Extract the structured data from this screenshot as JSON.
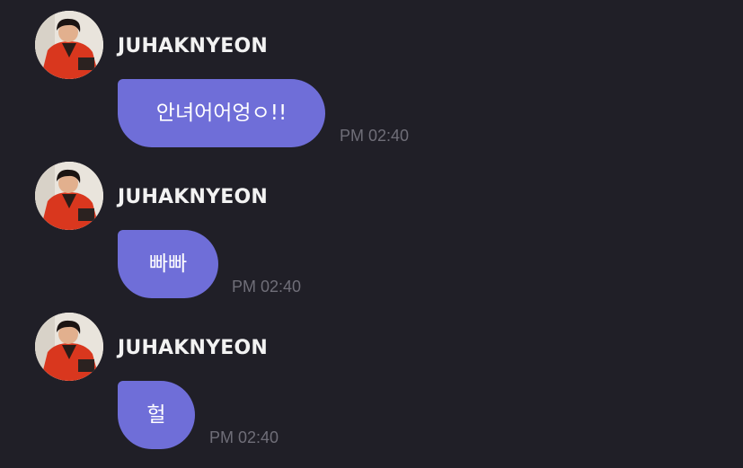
{
  "messages": [
    {
      "sender": "JUHAKNYEON",
      "text": "안녀어어엉ㅇ!!",
      "time": "PM 02:40"
    },
    {
      "sender": "JUHAKNYEON",
      "text": "빠빠",
      "time": "PM 02:40"
    },
    {
      "sender": "JUHAKNYEON",
      "text": "헐",
      "time": "PM 02:40"
    }
  ],
  "colors": {
    "background": "#201f27",
    "bubble": "#6f6ed8",
    "sender_text": "#f2f2f2",
    "timestamp": "#6f6e78"
  },
  "icons": {
    "avatar": "profile-photo"
  }
}
